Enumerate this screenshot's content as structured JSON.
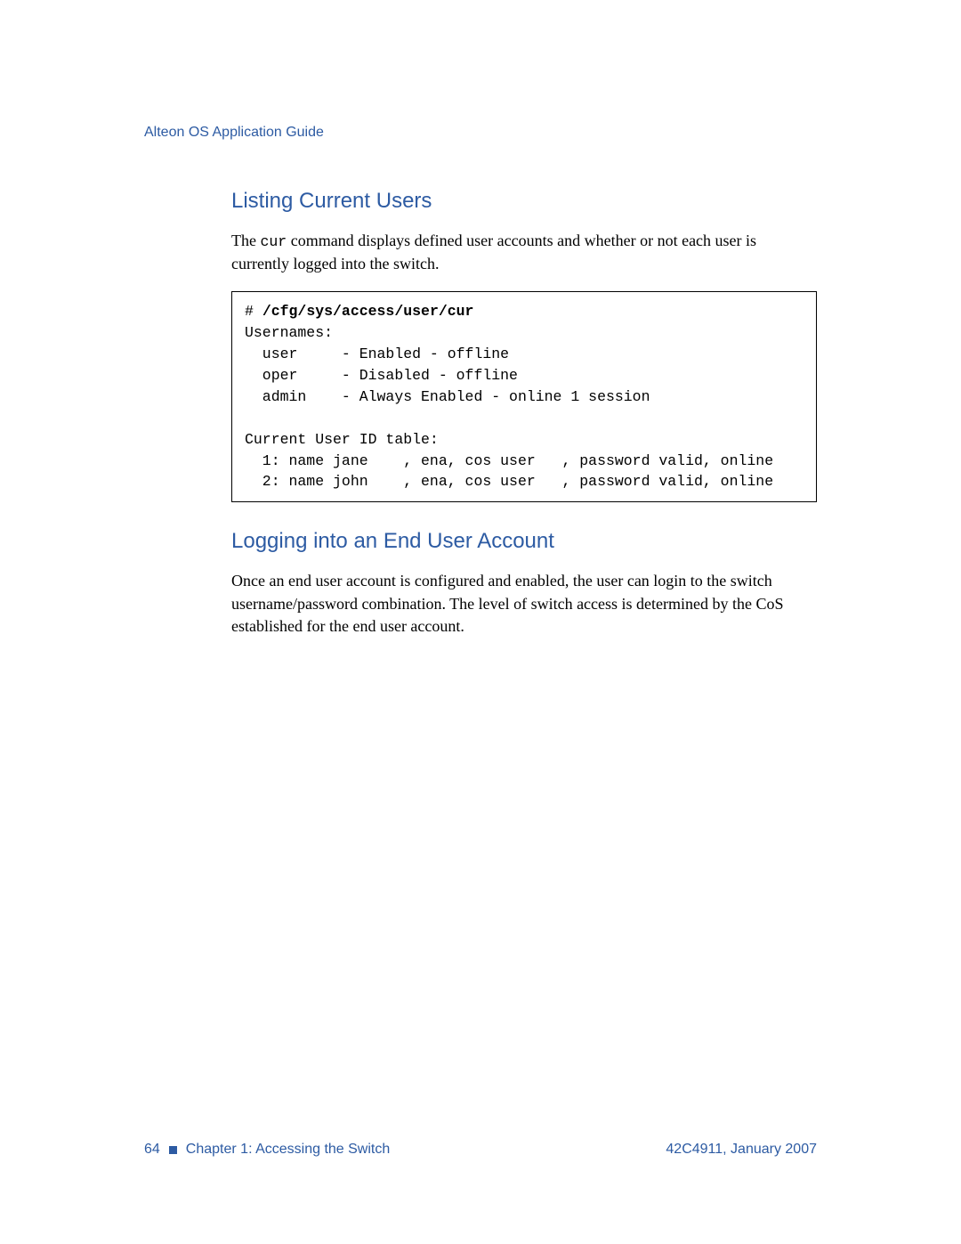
{
  "header": {
    "guide_title": "Alteon OS Application Guide"
  },
  "section1": {
    "heading": "Listing Current Users",
    "para_before_cmd": "The ",
    "cmd": "cur",
    "para_after_cmd": " command displays defined user accounts and whether or not each user is currently logged into the switch."
  },
  "code": {
    "prompt": "# ",
    "command": "/cfg/sys/access/user/cur",
    "output": "\nUsernames:\n  user     - Enabled - offline\n  oper     - Disabled - offline\n  admin    - Always Enabled - online 1 session\n\nCurrent User ID table:\n  1: name jane    , ena, cos user   , password valid, online\n  2: name john    , ena, cos user   , password valid, online"
  },
  "section2": {
    "heading": "Logging into an End User Account",
    "para": "Once an end user account is configured and enabled, the user can login to the switch username/password combination. The level of switch access is determined by the CoS established for the end user account."
  },
  "footer": {
    "page_number": "64",
    "chapter": "Chapter 1:  Accessing the Switch",
    "doc_ref": "42C4911, January 2007"
  }
}
